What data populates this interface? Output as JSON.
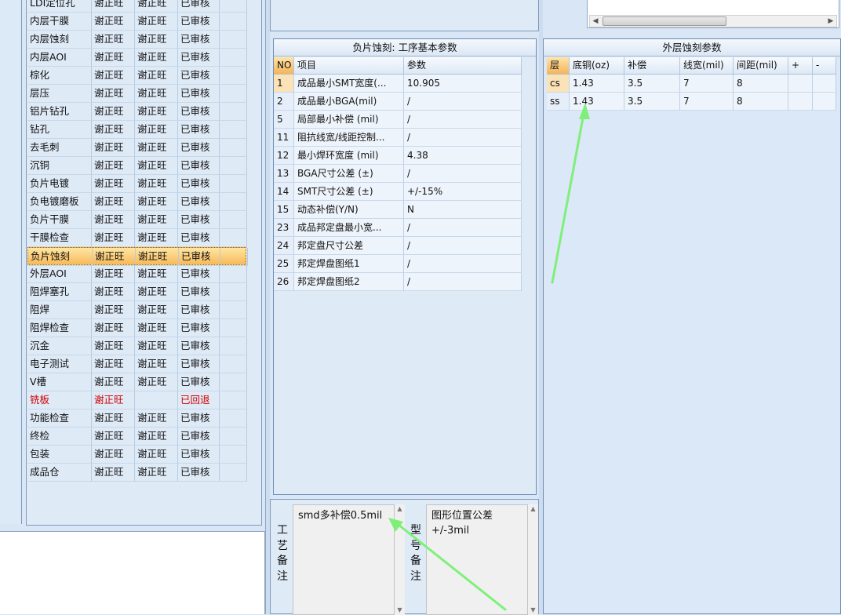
{
  "process_list": {
    "rows": [
      {
        "name": "LDI定位孔",
        "op1": "谢正旺",
        "op2": "谢正旺",
        "status": "已审核"
      },
      {
        "name": "内层干膜",
        "op1": "谢正旺",
        "op2": "谢正旺",
        "status": "已审核"
      },
      {
        "name": "内层蚀刻",
        "op1": "谢正旺",
        "op2": "谢正旺",
        "status": "已审核"
      },
      {
        "name": "内层AOI",
        "op1": "谢正旺",
        "op2": "谢正旺",
        "status": "已审核"
      },
      {
        "name": "棕化",
        "op1": "谢正旺",
        "op2": "谢正旺",
        "status": "已审核"
      },
      {
        "name": "层压",
        "op1": "谢正旺",
        "op2": "谢正旺",
        "status": "已审核"
      },
      {
        "name": "铝片钻孔",
        "op1": "谢正旺",
        "op2": "谢正旺",
        "status": "已审核"
      },
      {
        "name": "钻孔",
        "op1": "谢正旺",
        "op2": "谢正旺",
        "status": "已审核"
      },
      {
        "name": "去毛刺",
        "op1": "谢正旺",
        "op2": "谢正旺",
        "status": "已审核"
      },
      {
        "name": "沉铜",
        "op1": "谢正旺",
        "op2": "谢正旺",
        "status": "已审核"
      },
      {
        "name": "负片电镀",
        "op1": "谢正旺",
        "op2": "谢正旺",
        "status": "已审核"
      },
      {
        "name": "负电镀磨板",
        "op1": "谢正旺",
        "op2": "谢正旺",
        "status": "已审核"
      },
      {
        "name": "负片干膜",
        "op1": "谢正旺",
        "op2": "谢正旺",
        "status": "已审核"
      },
      {
        "name": "干膜检查",
        "op1": "谢正旺",
        "op2": "谢正旺",
        "status": "已审核"
      },
      {
        "name": "负片蚀刻",
        "op1": "谢正旺",
        "op2": "谢正旺",
        "status": "已审核"
      },
      {
        "name": "外层AOI",
        "op1": "谢正旺",
        "op2": "谢正旺",
        "status": "已审核"
      },
      {
        "name": "阻焊塞孔",
        "op1": "谢正旺",
        "op2": "谢正旺",
        "status": "已审核"
      },
      {
        "name": "阻焊",
        "op1": "谢正旺",
        "op2": "谢正旺",
        "status": "已审核"
      },
      {
        "name": "阻焊检查",
        "op1": "谢正旺",
        "op2": "谢正旺",
        "status": "已审核"
      },
      {
        "name": "沉金",
        "op1": "谢正旺",
        "op2": "谢正旺",
        "status": "已审核"
      },
      {
        "name": "电子测试",
        "op1": "谢正旺",
        "op2": "谢正旺",
        "status": "已审核"
      },
      {
        "name": "V槽",
        "op1": "谢正旺",
        "op2": "谢正旺",
        "status": "已审核"
      },
      {
        "name": "铣板",
        "op1": "谢正旺",
        "op2": "",
        "status": "已回退"
      },
      {
        "name": "功能检查",
        "op1": "谢正旺",
        "op2": "谢正旺",
        "status": "已审核"
      },
      {
        "name": "终检",
        "op1": "谢正旺",
        "op2": "谢正旺",
        "status": "已审核"
      },
      {
        "name": "包装",
        "op1": "谢正旺",
        "op2": "谢正旺",
        "status": "已审核"
      },
      {
        "name": "成品仓",
        "op1": "谢正旺",
        "op2": "谢正旺",
        "status": "已审核"
      }
    ],
    "selected_index": 14,
    "rejected_index": 22,
    "rejected_color": "#d10000",
    "selected_color": "#f7b95a"
  },
  "params_panel": {
    "title": "负片蚀刻: 工序基本参数",
    "headers": [
      "NO",
      "项目",
      "参数"
    ],
    "rows": [
      {
        "no": "1",
        "item": "成品最小SMT宽度(...",
        "value": "10.905"
      },
      {
        "no": "2",
        "item": "成品最小BGA(mil)",
        "value": "/"
      },
      {
        "no": "5",
        "item": "局部最小补偿 (mil)",
        "value": "/"
      },
      {
        "no": "11",
        "item": "阻抗线宽/线距控制...",
        "value": "/"
      },
      {
        "no": "12",
        "item": "最小焊环宽度 (mil)",
        "value": "4.38"
      },
      {
        "no": "13",
        "item": "BGA尺寸公差 (±)",
        "value": "/"
      },
      {
        "no": "14",
        "item": "SMT尺寸公差 (±)",
        "value": "+/-15%"
      },
      {
        "no": "15",
        "item": "动态补偿(Y/N)",
        "value": "N"
      },
      {
        "no": "23",
        "item": "成品邦定盘最小宽...",
        "value": "/"
      },
      {
        "no": "24",
        "item": "邦定盘尺寸公差",
        "value": "/"
      },
      {
        "no": "25",
        "item": "邦定焊盘图纸1",
        "value": "/"
      },
      {
        "no": "26",
        "item": "邦定焊盘图纸2",
        "value": "/"
      }
    ]
  },
  "remarks": {
    "process_label": "工艺备注",
    "process_text": "smd多补偿0.5mil",
    "model_label": "型号备注",
    "model_text": "图形位置公差+/-3mil"
  },
  "etch_panel": {
    "title": "外层蚀刻参数",
    "headers": [
      "层",
      "底铜(oz)",
      "补偿",
      "线宽(mil)",
      "间距(mil)",
      "+",
      "-"
    ],
    "rows": [
      {
        "layer": "cs",
        "copper": "1.43",
        "comp": "3.5",
        "width": "7",
        "spacing": "8"
      },
      {
        "layer": "ss",
        "copper": "1.43",
        "comp": "3.5",
        "width": "7",
        "spacing": "8"
      }
    ]
  },
  "icons": {
    "scroll_left": "scroll-left-arrow-icon",
    "scroll_right": "scroll-right-arrow-icon",
    "scroll_up": "scroll-up-arrow-icon",
    "scroll_down": "scroll-down-arrow-icon",
    "annotation_arrow": "annotation-arrow-icon"
  },
  "colors": {
    "annotation_arrow": "#7ef07a",
    "header_orange": "#f5b45a"
  }
}
